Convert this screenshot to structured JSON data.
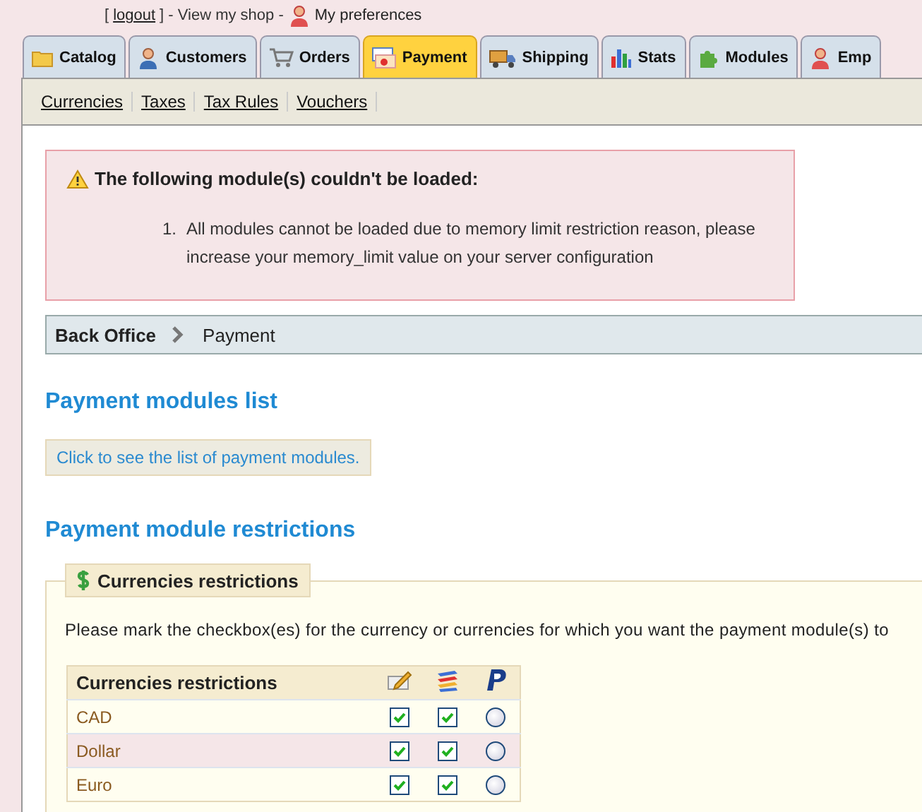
{
  "top_bar": {
    "open_bracket": "[",
    "logout": "logout",
    "middle": "] - View my shop -",
    "preferences": "My preferences"
  },
  "tabs": [
    {
      "label": "Catalog",
      "selected": false
    },
    {
      "label": "Customers",
      "selected": false
    },
    {
      "label": "Orders",
      "selected": false
    },
    {
      "label": "Payment",
      "selected": true
    },
    {
      "label": "Shipping",
      "selected": false
    },
    {
      "label": "Stats",
      "selected": false
    },
    {
      "label": "Modules",
      "selected": false
    },
    {
      "label": "Emp",
      "selected": false
    }
  ],
  "subnav": [
    "Currencies",
    "Taxes",
    "Tax Rules",
    "Vouchers"
  ],
  "alert": {
    "title": "The following module(s) couldn't be loaded:",
    "items": [
      {
        "number": "1.",
        "text": "All modules cannot be loaded due to memory limit restriction reason, please increase your memory_limit value on your server configuration"
      }
    ]
  },
  "breadcrumb": [
    "Back Office",
    "Payment"
  ],
  "modules_list": {
    "heading": "Payment modules list",
    "button": "Click to see the list of payment modules."
  },
  "restrictions": {
    "heading": "Payment module restrictions",
    "legend": "Currencies restrictions",
    "instructions": "Please mark the checkbox(es) for the currency or currencies for which you want the payment module(s) to",
    "table": {
      "header": "Currencies restrictions",
      "rows": [
        {
          "name": "CAD",
          "cells": [
            {
              "kind": "checkbox",
              "checked": true
            },
            {
              "kind": "checkbox",
              "checked": true
            },
            {
              "kind": "radio",
              "checked": false
            }
          ]
        },
        {
          "name": "Dollar",
          "cells": [
            {
              "kind": "checkbox",
              "checked": true
            },
            {
              "kind": "checkbox",
              "checked": true
            },
            {
              "kind": "radio",
              "checked": false
            }
          ]
        },
        {
          "name": "Euro",
          "cells": [
            {
              "kind": "checkbox",
              "checked": true
            },
            {
              "kind": "checkbox",
              "checked": true
            },
            {
              "kind": "radio",
              "checked": false
            }
          ]
        }
      ]
    }
  }
}
